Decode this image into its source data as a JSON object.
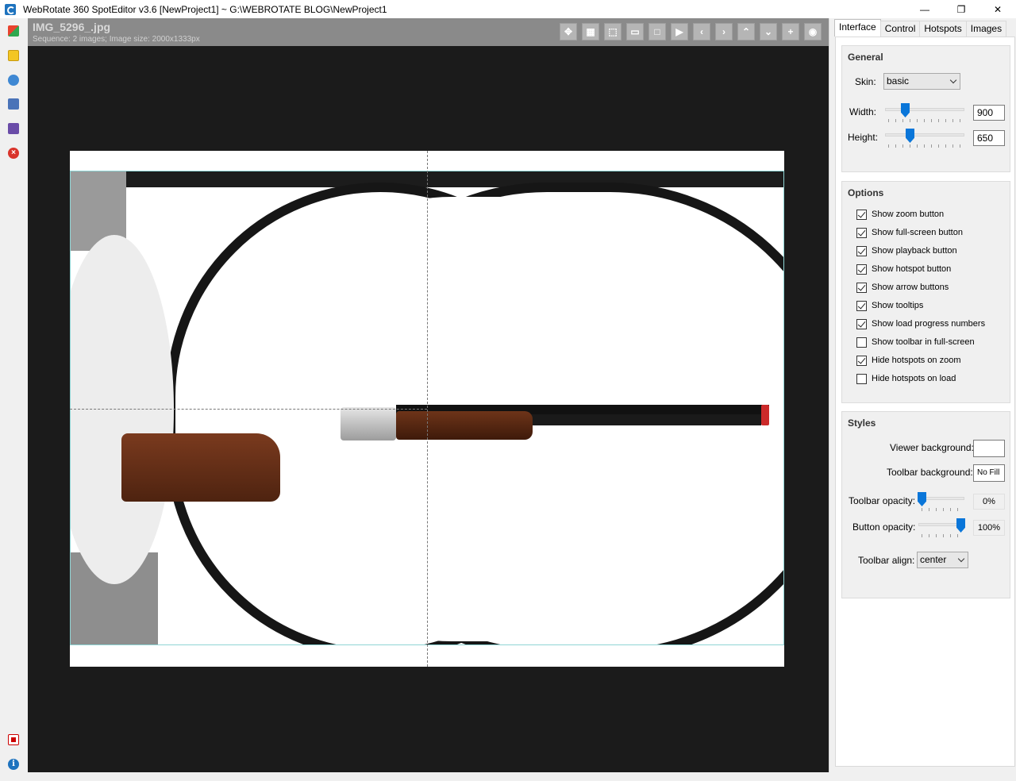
{
  "window": {
    "title": "WebRotate 360 SpotEditor v3.6 [NewProject1] ~ G:\\WEBROTATE BLOG\\NewProject1",
    "minimize": "—",
    "maximize": "❐",
    "close": "✕"
  },
  "left_toolbar": {
    "icons": [
      "add-images-icon",
      "open-project-icon",
      "preview-icon",
      "publish-icon",
      "save-icon",
      "close-project-icon",
      "pdf-help-icon",
      "info-icon"
    ]
  },
  "viewer": {
    "file_name": "IMG_5296_.jpg",
    "sequence_info": "Sequence: 2 images; Image size: 2000x1333px",
    "toolbar_buttons": [
      "move-icon",
      "grid-icon",
      "select-icon",
      "frame-icon",
      "fullscreen-icon",
      "play-icon",
      "arrow-left-icon",
      "arrow-right-icon",
      "arrow-up-icon",
      "arrow-down-icon",
      "zoom-icon",
      "hotspot-icon"
    ],
    "background": "#1b1b1b"
  },
  "panel": {
    "tabs": [
      "Interface",
      "Control",
      "Hotspots",
      "Images"
    ],
    "active_tab": "Interface",
    "general": {
      "title": "General",
      "skin_label": "Skin:",
      "skin_value": "basic",
      "width_label": "Width:",
      "width_value": "900",
      "height_label": "Height:",
      "height_value": "650"
    },
    "options": {
      "title": "Options",
      "items": [
        {
          "label": "Show zoom button",
          "checked": true
        },
        {
          "label": "Show full-screen button",
          "checked": true
        },
        {
          "label": "Show playback button",
          "checked": true
        },
        {
          "label": "Show hotspot button",
          "checked": true
        },
        {
          "label": "Show arrow buttons",
          "checked": true
        },
        {
          "label": "Show tooltips",
          "checked": true
        },
        {
          "label": "Show load progress numbers",
          "checked": true
        },
        {
          "label": "Show toolbar in full-screen",
          "checked": false
        },
        {
          "label": "Hide hotspots on zoom",
          "checked": true
        },
        {
          "label": "Hide hotspots on load",
          "checked": false
        }
      ]
    },
    "styles": {
      "title": "Styles",
      "viewer_bg_label": "Viewer background:",
      "viewer_bg_value": "",
      "toolbar_bg_label": "Toolbar background:",
      "toolbar_bg_value": "No Fill",
      "toolbar_opacity_label": "Toolbar opacity:",
      "toolbar_opacity_value": "0%",
      "button_opacity_label": "Button opacity:",
      "button_opacity_value": "100%",
      "toolbar_align_label": "Toolbar align:",
      "toolbar_align_value": "center"
    }
  },
  "colors": {
    "accent": "#0a76d9",
    "viewer_header": "#8a8a8a"
  }
}
